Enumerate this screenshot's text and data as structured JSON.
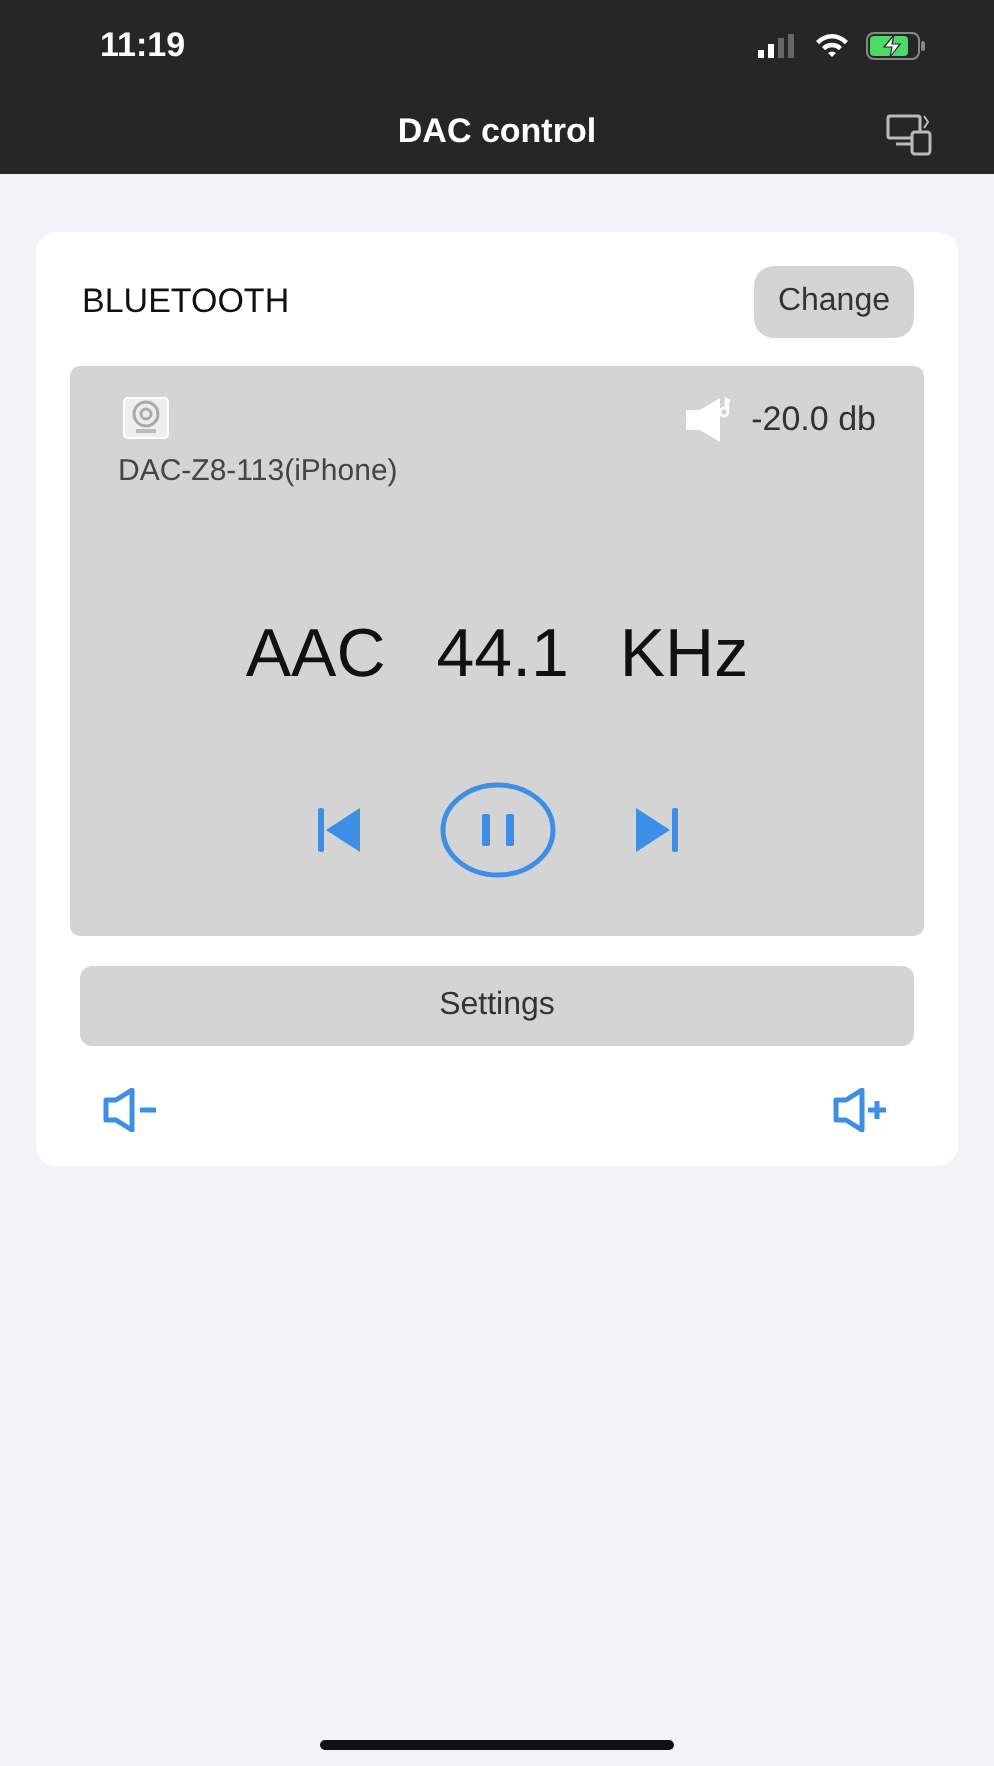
{
  "status_bar": {
    "time": "11:19"
  },
  "nav": {
    "title": "DAC control"
  },
  "source": {
    "label": "BLUETOOTH",
    "change_button": "Change"
  },
  "player": {
    "device": "DAC-Z8-113(iPhone)",
    "volume": "-20.0 db",
    "codec": "AAC",
    "sample_rate": "44.1 KHz",
    "playing": true
  },
  "settings_button": "Settings"
}
